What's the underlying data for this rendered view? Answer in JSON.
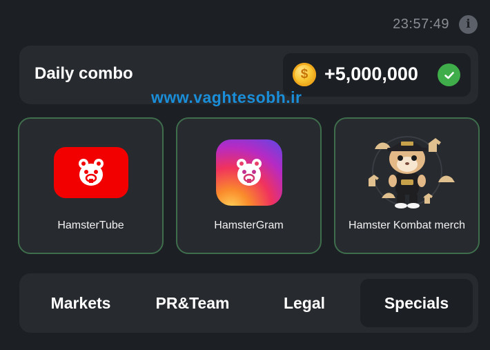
{
  "header": {
    "timer": "23:57:49",
    "info_icon": "info-icon"
  },
  "combo": {
    "title": "Daily combo",
    "reward": "+5,000,000",
    "coin_icon": "coin-icon",
    "coin_glyph": "$",
    "status_icon": "check-circle-icon",
    "status_color": "#3fae4a"
  },
  "watermark": "www.vaghtesobh.ir",
  "cards": [
    {
      "label": "HamsterTube",
      "icon": "hamster-tube-logo-icon",
      "color": "#f20000"
    },
    {
      "label": "HamsterGram",
      "icon": "hamster-gram-logo-icon"
    },
    {
      "label": "Hamster Kombat merch",
      "icon": "hamster-merch-icon"
    }
  ],
  "tabs": [
    {
      "label": "Markets",
      "selected": false
    },
    {
      "label": "PR&Team",
      "selected": false
    },
    {
      "label": "Legal",
      "selected": false
    },
    {
      "label": "Specials",
      "selected": true
    }
  ],
  "colors": {
    "background": "#1c1f24",
    "panel": "#272a2f",
    "card_border": "#3f6e4d",
    "watermark": "#1a8ed8",
    "timer": "#8a8e95"
  }
}
